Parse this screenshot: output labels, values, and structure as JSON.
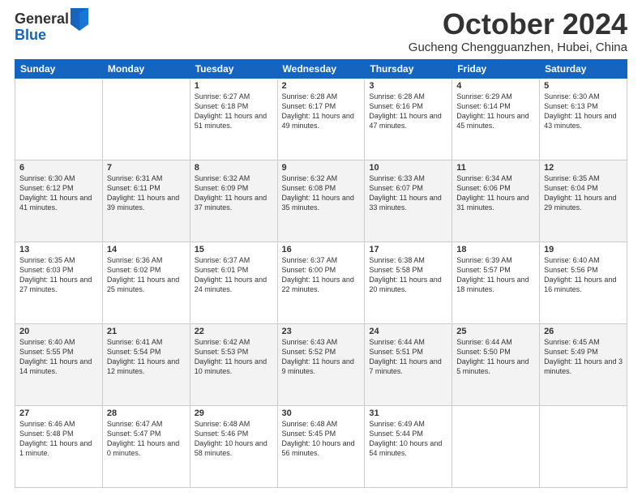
{
  "logo": {
    "general": "General",
    "blue": "Blue"
  },
  "header": {
    "month": "October 2024",
    "location": "Gucheng Chengguanzhen, Hubei, China"
  },
  "days_of_week": [
    "Sunday",
    "Monday",
    "Tuesday",
    "Wednesday",
    "Thursday",
    "Friday",
    "Saturday"
  ],
  "weeks": [
    [
      {
        "day": "",
        "info": ""
      },
      {
        "day": "",
        "info": ""
      },
      {
        "day": "1",
        "info": "Sunrise: 6:27 AM\nSunset: 6:18 PM\nDaylight: 11 hours and 51 minutes."
      },
      {
        "day": "2",
        "info": "Sunrise: 6:28 AM\nSunset: 6:17 PM\nDaylight: 11 hours and 49 minutes."
      },
      {
        "day": "3",
        "info": "Sunrise: 6:28 AM\nSunset: 6:16 PM\nDaylight: 11 hours and 47 minutes."
      },
      {
        "day": "4",
        "info": "Sunrise: 6:29 AM\nSunset: 6:14 PM\nDaylight: 11 hours and 45 minutes."
      },
      {
        "day": "5",
        "info": "Sunrise: 6:30 AM\nSunset: 6:13 PM\nDaylight: 11 hours and 43 minutes."
      }
    ],
    [
      {
        "day": "6",
        "info": "Sunrise: 6:30 AM\nSunset: 6:12 PM\nDaylight: 11 hours and 41 minutes."
      },
      {
        "day": "7",
        "info": "Sunrise: 6:31 AM\nSunset: 6:11 PM\nDaylight: 11 hours and 39 minutes."
      },
      {
        "day": "8",
        "info": "Sunrise: 6:32 AM\nSunset: 6:09 PM\nDaylight: 11 hours and 37 minutes."
      },
      {
        "day": "9",
        "info": "Sunrise: 6:32 AM\nSunset: 6:08 PM\nDaylight: 11 hours and 35 minutes."
      },
      {
        "day": "10",
        "info": "Sunrise: 6:33 AM\nSunset: 6:07 PM\nDaylight: 11 hours and 33 minutes."
      },
      {
        "day": "11",
        "info": "Sunrise: 6:34 AM\nSunset: 6:06 PM\nDaylight: 11 hours and 31 minutes."
      },
      {
        "day": "12",
        "info": "Sunrise: 6:35 AM\nSunset: 6:04 PM\nDaylight: 11 hours and 29 minutes."
      }
    ],
    [
      {
        "day": "13",
        "info": "Sunrise: 6:35 AM\nSunset: 6:03 PM\nDaylight: 11 hours and 27 minutes."
      },
      {
        "day": "14",
        "info": "Sunrise: 6:36 AM\nSunset: 6:02 PM\nDaylight: 11 hours and 25 minutes."
      },
      {
        "day": "15",
        "info": "Sunrise: 6:37 AM\nSunset: 6:01 PM\nDaylight: 11 hours and 24 minutes."
      },
      {
        "day": "16",
        "info": "Sunrise: 6:37 AM\nSunset: 6:00 PM\nDaylight: 11 hours and 22 minutes."
      },
      {
        "day": "17",
        "info": "Sunrise: 6:38 AM\nSunset: 5:58 PM\nDaylight: 11 hours and 20 minutes."
      },
      {
        "day": "18",
        "info": "Sunrise: 6:39 AM\nSunset: 5:57 PM\nDaylight: 11 hours and 18 minutes."
      },
      {
        "day": "19",
        "info": "Sunrise: 6:40 AM\nSunset: 5:56 PM\nDaylight: 11 hours and 16 minutes."
      }
    ],
    [
      {
        "day": "20",
        "info": "Sunrise: 6:40 AM\nSunset: 5:55 PM\nDaylight: 11 hours and 14 minutes."
      },
      {
        "day": "21",
        "info": "Sunrise: 6:41 AM\nSunset: 5:54 PM\nDaylight: 11 hours and 12 minutes."
      },
      {
        "day": "22",
        "info": "Sunrise: 6:42 AM\nSunset: 5:53 PM\nDaylight: 11 hours and 10 minutes."
      },
      {
        "day": "23",
        "info": "Sunrise: 6:43 AM\nSunset: 5:52 PM\nDaylight: 11 hours and 9 minutes."
      },
      {
        "day": "24",
        "info": "Sunrise: 6:44 AM\nSunset: 5:51 PM\nDaylight: 11 hours and 7 minutes."
      },
      {
        "day": "25",
        "info": "Sunrise: 6:44 AM\nSunset: 5:50 PM\nDaylight: 11 hours and 5 minutes."
      },
      {
        "day": "26",
        "info": "Sunrise: 6:45 AM\nSunset: 5:49 PM\nDaylight: 11 hours and 3 minutes."
      }
    ],
    [
      {
        "day": "27",
        "info": "Sunrise: 6:46 AM\nSunset: 5:48 PM\nDaylight: 11 hours and 1 minute."
      },
      {
        "day": "28",
        "info": "Sunrise: 6:47 AM\nSunset: 5:47 PM\nDaylight: 11 hours and 0 minutes."
      },
      {
        "day": "29",
        "info": "Sunrise: 6:48 AM\nSunset: 5:46 PM\nDaylight: 10 hours and 58 minutes."
      },
      {
        "day": "30",
        "info": "Sunrise: 6:48 AM\nSunset: 5:45 PM\nDaylight: 10 hours and 56 minutes."
      },
      {
        "day": "31",
        "info": "Sunrise: 6:49 AM\nSunset: 5:44 PM\nDaylight: 10 hours and 54 minutes."
      },
      {
        "day": "",
        "info": ""
      },
      {
        "day": "",
        "info": ""
      }
    ]
  ]
}
